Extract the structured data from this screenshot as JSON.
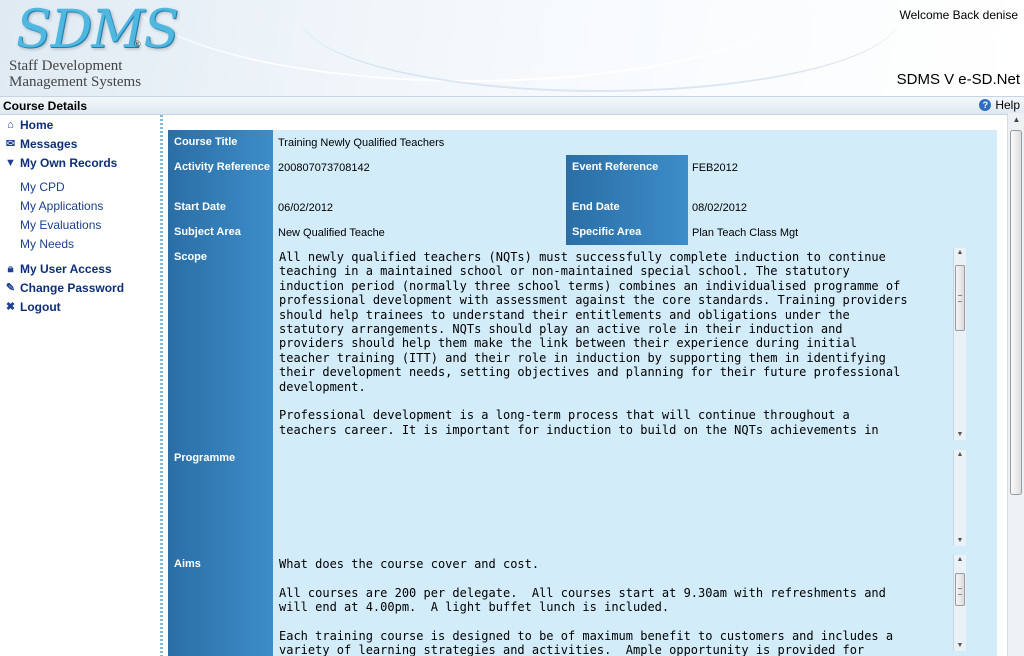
{
  "header": {
    "logo_text": "SDMS",
    "logo_registered": "®",
    "logo_subtitle": "Staff Development Management Systems",
    "welcome": "Welcome Back denise",
    "version": "SDMS V e-SD.Net"
  },
  "titlebar": {
    "title": "Course Details",
    "help_label": "Help"
  },
  "sidebar": {
    "home": "Home",
    "messages": "Messages",
    "my_own_records": "My Own Records",
    "sub_items": [
      "My CPD",
      "My Applications",
      "My Evaluations",
      "My Needs"
    ],
    "my_user_access": "My User Access",
    "change_password": "Change Password",
    "logout": "Logout"
  },
  "course": {
    "course_title_label": "Course Title",
    "course_title": "Training Newly Qualified Teachers",
    "activity_reference_label": "Activity Reference",
    "activity_reference": "200807073708142",
    "event_reference_label": "Event Reference",
    "event_reference": "FEB2012",
    "start_date_label": "Start Date",
    "start_date": "06/02/2012",
    "end_date_label": "End Date",
    "end_date": "08/02/2012",
    "subject_area_label": "Subject Area",
    "subject_area": "New Qualified Teache",
    "specific_area_label": "Specific Area",
    "specific_area": "Plan Teach Class Mgt",
    "scope_label": "Scope",
    "scope_text": "All newly qualified teachers (NQTs) must successfully complete induction to continue\nteaching in a maintained school or non-maintained special school. The statutory\ninduction period (normally three school terms) combines an individualised programme of\nprofessional development with assessment against the core standards. Training providers\nshould help trainees to understand their entitlements and obligations under the\nstatutory arrangements. NQTs should play an active role in their induction and\nproviders should help them make the link between their experience during initial\nteacher training (ITT) and their role in induction by supporting them in identifying\ntheir development needs, setting objectives and planning for their future professional\ndevelopment.\n\nProfessional development is a long-term process that will continue throughout a\nteachers career. It is important for induction to build on the NQTs achievements in\nmeeting the qualified teacher status (QTS) standards during initial teacher training",
    "programme_label": "Programme",
    "programme_text": "",
    "aims_label": "Aims",
    "aims_text": "What does the course cover and cost.\n\nAll courses are 200 per delegate.  All courses start at 9.30am with refreshments and\nwill end at 4.00pm.  A light buffet lunch is included.\n\nEach training course is designed to be of maximum benefit to customers and includes a\nvariety of learning strategies and activities.  Ample opportunity is provided for"
  }
}
